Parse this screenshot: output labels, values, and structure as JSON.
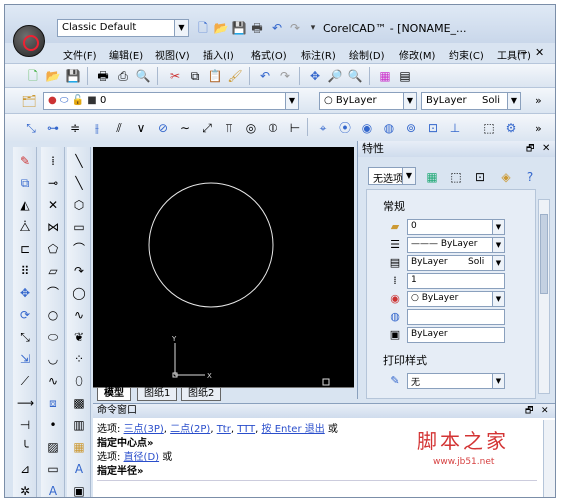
{
  "titlebar": {
    "workspace": "Classic Default",
    "title": "CorelCAD™ - [NONAME_..."
  },
  "menu": [
    "文件(F)",
    "编辑(E)",
    "视图(V)",
    "插入(I)",
    "格式(O)",
    "标注(R)",
    "绘制(D)",
    "修改(M)",
    "约束(C)",
    "工具(T)"
  ],
  "layer_toolbar": {
    "layer_value": "0",
    "color": "ByLayer",
    "linestyle": "ByLayer",
    "lineweight": "Soli"
  },
  "drawing": {
    "tabs": [
      "模型",
      "图纸1",
      "图纸2"
    ],
    "axis_x": "X",
    "axis_y": "Y"
  },
  "properties": {
    "title": "特性",
    "selection": "无选项",
    "section_general": "常规",
    "fields": [
      "0",
      "ByLayer",
      "ByLayer",
      "Soli",
      "1",
      "ByLayer",
      "ByLayer"
    ],
    "section_print": "打印样式",
    "print_value": "无"
  },
  "command": {
    "title": "命令窗口",
    "line1_prefix": "选项:",
    "line1_opt1": "三点(3P)",
    "line1_opt2": "二点(2P)",
    "line1_opt3": "Ttr",
    "line1_opt4": "TTT",
    "line1_opt5": "按 Enter 退出",
    "line1_suffix": "或",
    "line2": "指定中心点»",
    "line3_prefix": "选项:",
    "line3_opt": "直径(D)",
    "line3_suffix": "或",
    "line4": "指定半径»"
  },
  "watermark": {
    "line1": "脚本之家",
    "line2": "www.jb51.net"
  },
  "colors": {
    "canvas": "#000000",
    "chrome": "#d9e4f1",
    "link": "#2a4ecb",
    "watermark": "#cc1111"
  }
}
